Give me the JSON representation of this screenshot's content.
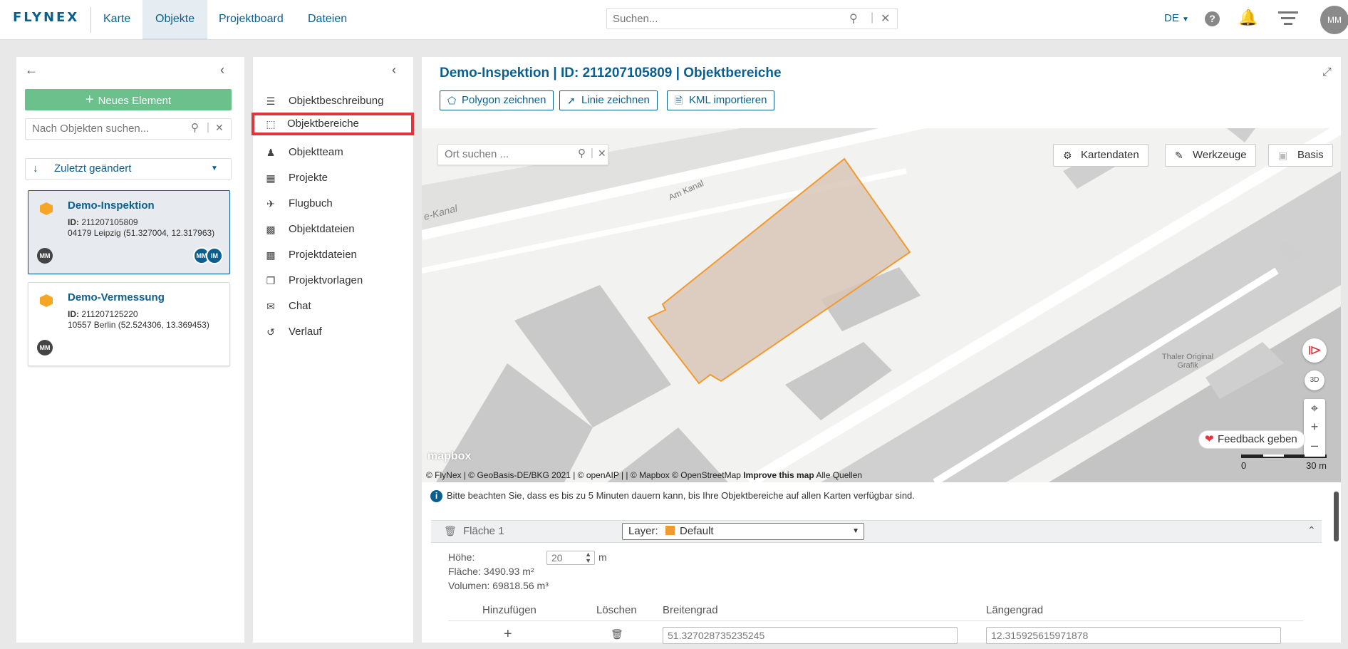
{
  "app": {
    "logo": "FLYNEX"
  },
  "nav": {
    "items": [
      {
        "label": "Karte"
      },
      {
        "label": "Objekte"
      },
      {
        "label": "Projektboard"
      },
      {
        "label": "Dateien"
      }
    ]
  },
  "search": {
    "placeholder": "Suchen..."
  },
  "header": {
    "lang": "DE",
    "help": "?",
    "avatar": "MM"
  },
  "left": {
    "new_button": "Neues Element",
    "search_placeholder": "Nach Objekten suchen...",
    "sort_label": "Zuletzt geändert",
    "cards": [
      {
        "title": "Demo-Inspektion",
        "id_label": "ID:",
        "id": "211207105809",
        "address": "04179 Leipzig (51.327004, 12.317963)",
        "owner": "MM",
        "members": [
          "MM",
          "IM"
        ]
      },
      {
        "title": "Demo-Vermessung",
        "id_label": "ID:",
        "id": "211207125220",
        "address": "10557 Berlin (52.524306, 13.369453)",
        "owner": "MM"
      }
    ]
  },
  "menu": {
    "items": [
      {
        "label": "Objektbeschreibung",
        "icon": "list-icon"
      },
      {
        "label": "Objektbereiche",
        "icon": "area-select-icon"
      },
      {
        "label": "Objektteam",
        "icon": "team-icon"
      },
      {
        "label": "Projekte",
        "icon": "sitemap-icon"
      },
      {
        "label": "Flugbuch",
        "icon": "plane-icon"
      },
      {
        "label": "Objektdateien",
        "icon": "folder-icon"
      },
      {
        "label": "Projektdateien",
        "icon": "folder-icon"
      },
      {
        "label": "Projektvorlagen",
        "icon": "template-icon"
      },
      {
        "label": "Chat",
        "icon": "chat-icon"
      },
      {
        "label": "Verlauf",
        "icon": "history-icon"
      }
    ]
  },
  "main": {
    "title": "Demo-Inspektion | ID: 211207105809 | Objektbereiche",
    "buttons": {
      "polygon": "Polygon zeichnen",
      "line": "Linie zeichnen",
      "kml": "KML importieren"
    },
    "map": {
      "search_placeholder": "Ort suchen ...",
      "kartendaten": "Kartendaten",
      "werkzeuge": "Werkzeuge",
      "basis": "Basis",
      "label_3d": "3D",
      "feedback": "Feedback geben",
      "scale_min": "0",
      "scale_max": "30 m",
      "street1": "Am Kanal",
      "street2": "e-Kanal",
      "poi": "Thaler Original Grafik",
      "mapbox_logo": "mapbox",
      "attribution": "© FlyNex | © GeoBasis-DE/BKG 2021 | © openAIP | | © Mapbox © OpenStreetMap",
      "improve": "Improve this map",
      "sources": "Alle Quellen",
      "polygon_fill": "#d9c6b7",
      "polygon_stroke": "#f29a2e"
    },
    "info": "Bitte beachten Sie, dass es bis zu 5 Minuten dauern kann, bis Ihre Objektbereiche auf allen Karten verfügbar sind.",
    "area": {
      "name": "Fläche 1",
      "layer_label": "Layer:",
      "layer_value": "Default",
      "layer_color": "#f29a2e",
      "height_label": "Höhe:",
      "height_value": "20",
      "height_unit": "m",
      "area_text": "Fläche: 3490.93 m²",
      "volume_text": "Volumen: 69818.56 m³",
      "table_headers": [
        "Hinzufügen",
        "Löschen",
        "Breitengrad",
        "Längengrad"
      ],
      "rows": [
        {
          "lat": "51.327028735235245",
          "lng": "12.315925615971878"
        }
      ]
    }
  }
}
